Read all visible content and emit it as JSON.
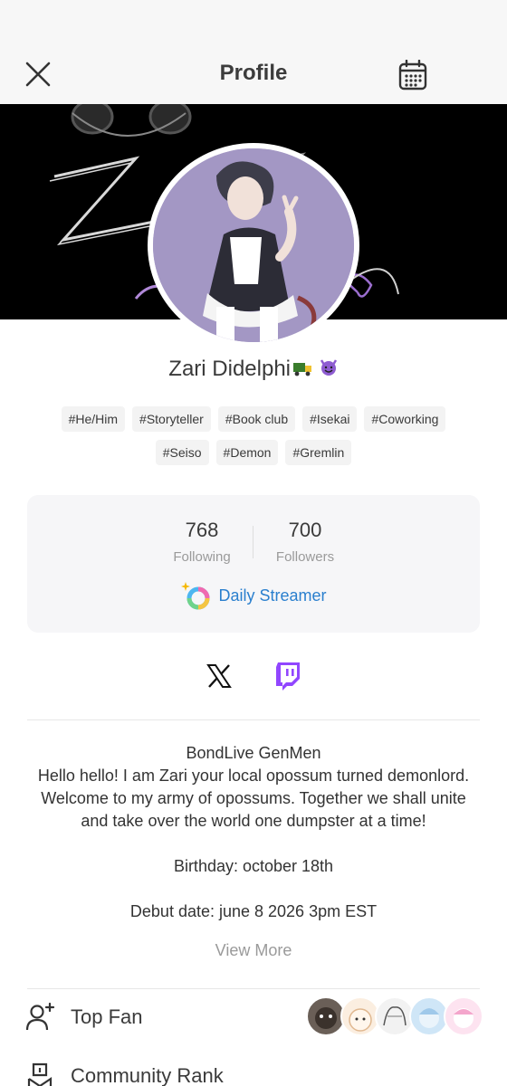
{
  "header": {
    "title": "Profile",
    "close_icon": "close-icon",
    "calendar_icon": "calendar-icon"
  },
  "profile": {
    "name": "Zari Didelphi",
    "name_emojis": [
      "garbage-truck-emoji",
      "smiling-devil-emoji"
    ],
    "tags_row1": [
      "#He/Him",
      "#Storyteller",
      "#Book club",
      "#Isekai",
      "#Coworking"
    ],
    "tags_row2": [
      "#Seiso",
      "#Demon",
      "#Gremlin"
    ]
  },
  "stats": {
    "following_count": "768",
    "following_label": "Following",
    "followers_count": "700",
    "followers_label": "Followers",
    "badge_label": "Daily Streamer",
    "badge_icon": "rainbow-ring-icon"
  },
  "socials": [
    {
      "icon": "x-logo-icon"
    },
    {
      "icon": "twitch-logo-icon"
    }
  ],
  "bio": {
    "text": "BondLive GenMen\nHello hello! I am Zari your local opossum turned demonlord. Welcome to my army of opossums. Together we shall unite and take over the world one dumpster at a time!\n\nBirthday: october 18th\n\nDebut date: june 8 2026 3pm EST",
    "view_more": "View More"
  },
  "rows": {
    "top_fan_label": "Top Fan",
    "community_rank_label": "Community Rank"
  },
  "colors": {
    "accent_blue": "#2a7fce",
    "twitch_purple": "#9146ff",
    "banner_bg": "#000000",
    "avatar_bg": "#a397c4"
  }
}
